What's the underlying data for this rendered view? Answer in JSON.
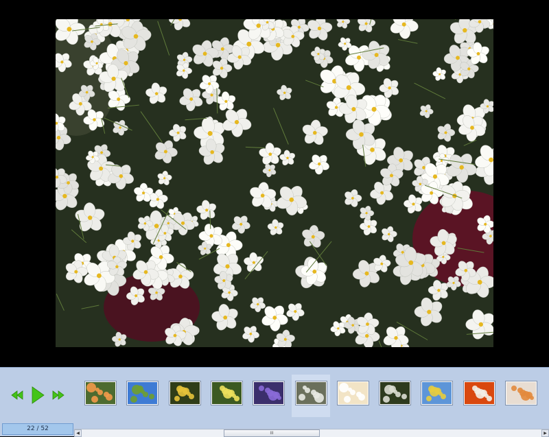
{
  "viewer": {
    "main_photo": "white-primrose-flowers-photo"
  },
  "controls": {
    "rewind_icon": "rewind-icon",
    "play_icon": "play-icon",
    "fast_forward_icon": "fast-forward-icon",
    "accent_color": "#44c418"
  },
  "thumbnails": [
    {
      "subject": "orange-rose",
      "colors": [
        "#4d6b30",
        "#f39a4a"
      ]
    },
    {
      "subject": "meadow-landscape",
      "colors": [
        "#3e7bd4",
        "#6f9e2e"
      ]
    },
    {
      "subject": "yellow-flowers",
      "colors": [
        "#2f3d18",
        "#e6c23a"
      ]
    },
    {
      "subject": "yellow-daisy",
      "colors": [
        "#3c5a22",
        "#ede05c"
      ]
    },
    {
      "subject": "purple-flowers",
      "colors": [
        "#3b2f6c",
        "#8a6ad8"
      ]
    },
    {
      "subject": "white-flowers",
      "colors": [
        "#6b705c",
        "#e8e9e2"
      ],
      "selected": true
    },
    {
      "subject": "white-lily",
      "colors": [
        "#f2e4c6",
        "#ffffff"
      ]
    },
    {
      "subject": "white-blossom",
      "colors": [
        "#2e3b1e",
        "#dcded2"
      ]
    },
    {
      "subject": "yellow-flowers-sky",
      "colors": [
        "#5d95d8",
        "#e7cc3e"
      ]
    },
    {
      "subject": "dandelion-orange",
      "colors": [
        "#d9480f",
        "#f2eee6"
      ]
    },
    {
      "subject": "flower-bouquet",
      "colors": [
        "#e8ddd2",
        "#e28a3c"
      ]
    }
  ],
  "counter": {
    "text": "22 / 52"
  },
  "scrollbar": {
    "grip": "III"
  }
}
